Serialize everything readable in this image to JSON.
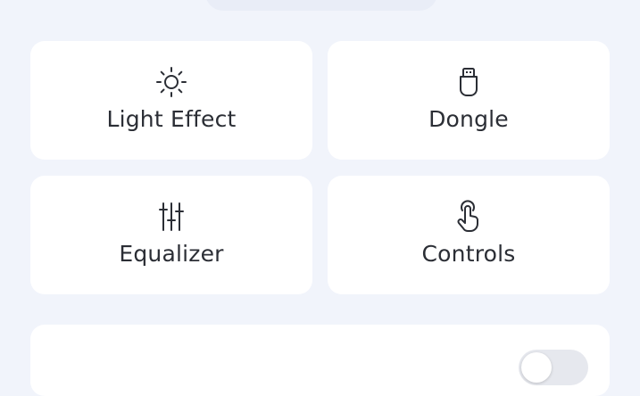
{
  "colors": {
    "background": "#f1f4fb",
    "card": "#ffffff",
    "text": "#2b2e35",
    "icon_stroke": "#2b2e35",
    "toggle_track": "#e6e8ee"
  },
  "tiles": [
    {
      "label": "Light Effect",
      "icon": "sun-icon"
    },
    {
      "label": "Dongle",
      "icon": "usb-dongle-icon"
    },
    {
      "label": "Equalizer",
      "icon": "equalizer-sliders-icon"
    },
    {
      "label": "Controls",
      "icon": "touch-gesture-icon"
    }
  ],
  "bottom_card": {
    "toggle_state": "off"
  }
}
